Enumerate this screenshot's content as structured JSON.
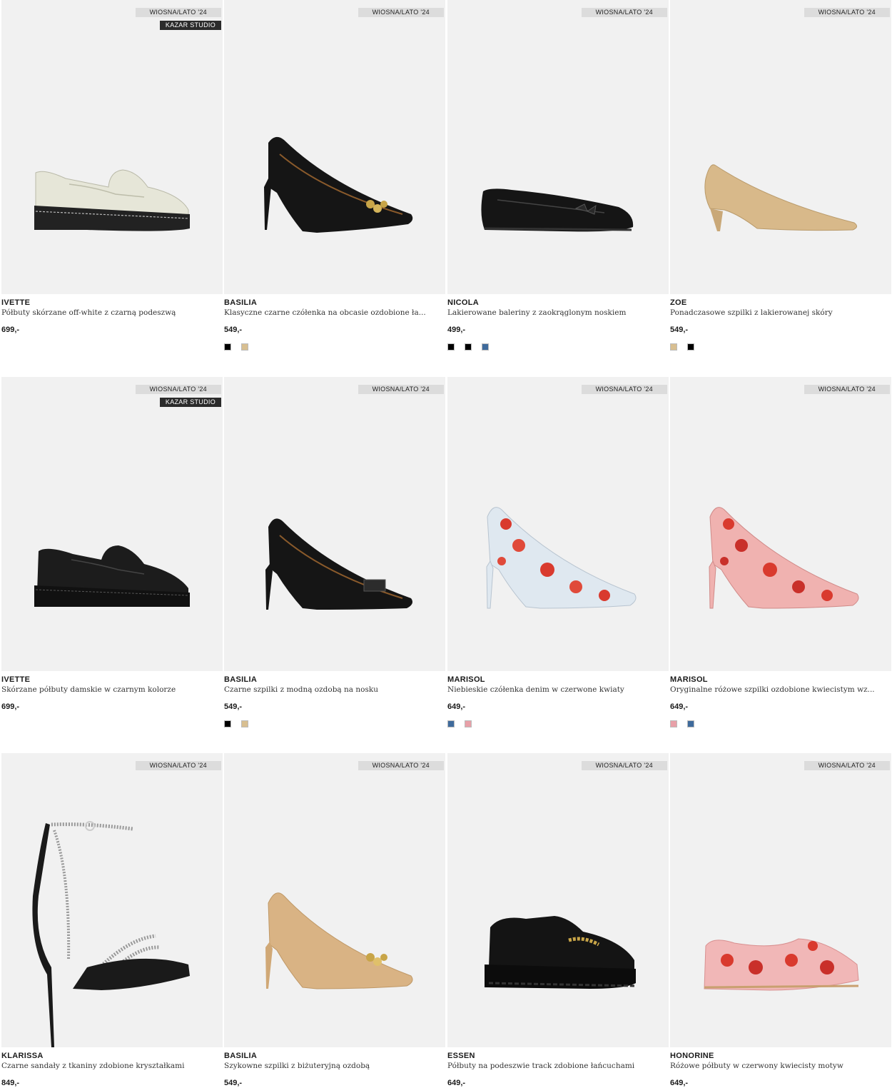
{
  "products": [
    {
      "badge": "WIOSNA/LATO '24",
      "studio": "KAZAR STUDIO",
      "brand": "IVETTE",
      "desc": "Półbuty skórzane off-white z czarną podeszwą",
      "price": "699,-",
      "swatches": [],
      "shoe": "loafer-white"
    },
    {
      "badge": "WIOSNA/LATO '24",
      "studio": "",
      "brand": "BASILIA",
      "desc": "Klasyczne czarne czółenka na obcasie ozdobione ła...",
      "price": "549,-",
      "swatches": [
        "#000000",
        "#d8bf91"
      ],
      "shoe": "pump-black-chain"
    },
    {
      "badge": "WIOSNA/LATO '24",
      "studio": "",
      "brand": "NICOLA",
      "desc": "Lakierowane baleriny z zaokrąglonym noskiem",
      "price": "499,-",
      "swatches": [
        "#000000",
        "#000000",
        "#3f6b9c"
      ],
      "shoe": "ballerina-black"
    },
    {
      "badge": "WIOSNA/LATO '24",
      "studio": "",
      "brand": "ZOE",
      "desc": "Ponadczasowe szpilki z lakierowanej skóry",
      "price": "549,-",
      "swatches": [
        "#d8bf91",
        "#000000"
      ],
      "shoe": "kitten-beige"
    },
    {
      "badge": "WIOSNA/LATO '24",
      "studio": "KAZAR STUDIO",
      "brand": "IVETTE",
      "desc": "Skórzane półbuty damskie w czarnym kolorze",
      "price": "699,-",
      "swatches": [],
      "shoe": "loafer-black"
    },
    {
      "badge": "WIOSNA/LATO '24",
      "studio": "",
      "brand": "BASILIA",
      "desc": "Czarne szpilki z modną ozdobą na nosku",
      "price": "549,-",
      "swatches": [
        "#000000",
        "#d8bf91"
      ],
      "shoe": "pump-black-buckle"
    },
    {
      "badge": "WIOSNA/LATO '24",
      "studio": "",
      "brand": "MARISOL",
      "desc": "Niebieskie czółenka denim w czerwone kwiaty",
      "price": "649,-",
      "swatches": [
        "#3f6b9c",
        "#e8a0a8"
      ],
      "shoe": "pump-floral-blue"
    },
    {
      "badge": "WIOSNA/LATO '24",
      "studio": "",
      "brand": "MARISOL",
      "desc": "Oryginalne różowe szpilki ozdobione kwiecistym wz...",
      "price": "649,-",
      "swatches": [
        "#e8a0a8",
        "#3f6b9c"
      ],
      "shoe": "pump-floral-pink"
    },
    {
      "badge": "WIOSNA/LATO '24",
      "studio": "",
      "brand": "KLARISSA",
      "desc": "Czarne sandały z tkaniny zdobione kryształkami",
      "price": "849,-",
      "swatches": [],
      "shoe": "sandal-black"
    },
    {
      "badge": "WIOSNA/LATO '24",
      "studio": "",
      "brand": "BASILIA",
      "desc": "Szykowne szpilki z biżuteryjną ozdobą",
      "price": "549,-",
      "swatches": [],
      "shoe": "pump-beige-chain"
    },
    {
      "badge": "WIOSNA/LATO '24",
      "studio": "",
      "brand": "ESSEN",
      "desc": "Półbuty na podeszwie track zdobione łańcuchami",
      "price": "649,-",
      "swatches": [],
      "shoe": "loafer-track-black"
    },
    {
      "badge": "WIOSNA/LATO '24",
      "studio": "",
      "brand": "HONORINE",
      "desc": "Różowe półbuty w czerwony kwiecisty motyw",
      "price": "649,-",
      "swatches": [],
      "shoe": "loafer-floral-pink"
    }
  ]
}
